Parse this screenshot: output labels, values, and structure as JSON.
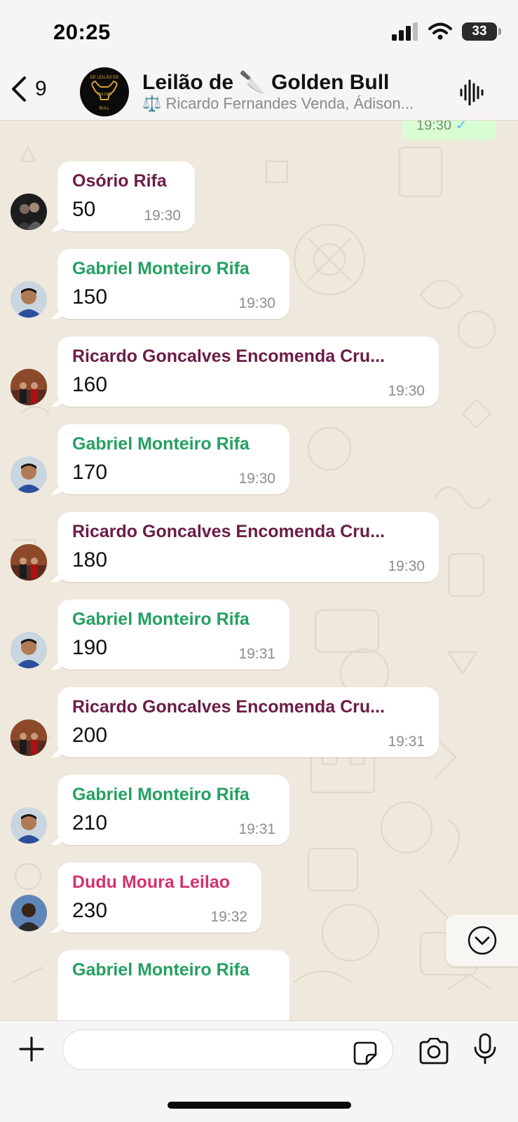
{
  "status_bar": {
    "time": "20:25",
    "battery": "33"
  },
  "header": {
    "back_count": "9",
    "title": "Leilão de 🔪 Golden Bull",
    "subtitle": "⚖️ Ricardo Fernandes Venda, Ádison...",
    "avatar_text_top": "DE LEILÃO DE",
    "avatar_text_mid": "GOLDEN",
    "avatar_text_bottom": "BULL"
  },
  "peek_message": {
    "time": "19:30"
  },
  "messages": [
    {
      "sender": "Osório Rifa",
      "text": "50",
      "time": "19:30",
      "color": "#6b1d46"
    },
    {
      "sender": "Gabriel Monteiro Rifa",
      "text": "150",
      "time": "19:30",
      "color": "#25a062"
    },
    {
      "sender": "Ricardo Goncalves Encomenda Cru...",
      "text": "160",
      "time": "19:30",
      "color": "#6b1d46"
    },
    {
      "sender": "Gabriel Monteiro Rifa",
      "text": "170",
      "time": "19:30",
      "color": "#25a062"
    },
    {
      "sender": "Ricardo Goncalves Encomenda Cru...",
      "text": "180",
      "time": "19:30",
      "color": "#6b1d46"
    },
    {
      "sender": "Gabriel Monteiro Rifa",
      "text": "190",
      "time": "19:31",
      "color": "#25a062"
    },
    {
      "sender": "Ricardo Goncalves Encomenda Cru...",
      "text": "200",
      "time": "19:31",
      "color": "#6b1d46"
    },
    {
      "sender": "Gabriel Monteiro Rifa",
      "text": "210",
      "time": "19:31",
      "color": "#25a062"
    },
    {
      "sender": "Dudu Moura Leilao",
      "text": "230",
      "time": "19:32",
      "color": "#d43270"
    },
    {
      "sender": "Gabriel Monteiro Rifa",
      "text": "",
      "time": "",
      "color": "#25a062"
    }
  ],
  "composer": {
    "placeholder": ""
  },
  "icons": {
    "back": "chevron-left-icon",
    "voice_chat": "waveform-icon",
    "scroll_down": "chevron-down-circle-icon",
    "attach": "plus-icon",
    "sticker": "sticker-icon",
    "camera": "camera-icon",
    "mic": "microphone-icon"
  }
}
